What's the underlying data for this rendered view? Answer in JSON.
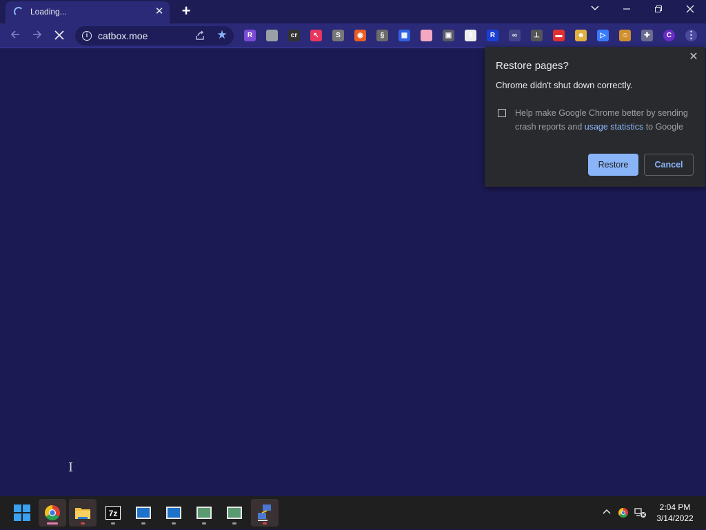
{
  "tab": {
    "title": "Loading..."
  },
  "toolbar": {
    "url": "catbox.moe"
  },
  "extensions": [
    {
      "name": "reader-ext-icon",
      "letter": "R",
      "color": "#7b4bd6"
    },
    {
      "name": "cloud-ext-icon",
      "letter": "",
      "color": "#9aa0a6"
    },
    {
      "name": "cr-ext-icon",
      "letter": "cr",
      "color": "#333333"
    },
    {
      "name": "cursor-ext-icon",
      "letter": "↖",
      "color": "#e8365d"
    },
    {
      "name": "s-ext-icon",
      "letter": "S",
      "color": "#777777"
    },
    {
      "name": "color-ext-icon",
      "letter": "◉",
      "color": "#e85d26"
    },
    {
      "name": "script-ext-icon",
      "letter": "§",
      "color": "#6b6b6b"
    },
    {
      "name": "grid-ext-icon",
      "letter": "▦",
      "color": "#2f63e0"
    },
    {
      "name": "flag-ext-icon",
      "letter": "",
      "color": "#f3a8c0"
    },
    {
      "name": "image-ext-icon",
      "letter": "▣",
      "color": "#5a5a6a"
    },
    {
      "name": "dollar-ext-icon",
      "letter": "$",
      "color": "#eeeeee"
    },
    {
      "name": "r-ext-icon",
      "letter": "R",
      "color": "#1a3fd6"
    },
    {
      "name": "link-ext-icon",
      "letter": "∞",
      "color": "#444488"
    },
    {
      "name": "stamp-ext-icon",
      "letter": "⊥",
      "color": "#555555"
    },
    {
      "name": "card-ext-icon",
      "letter": "▬",
      "color": "#e03030"
    },
    {
      "name": "cat-ext-icon",
      "letter": "☻",
      "color": "#e0b040"
    },
    {
      "name": "play-ext-icon",
      "letter": "▷",
      "color": "#3a7bfd"
    },
    {
      "name": "monkey-ext-icon",
      "letter": "☺",
      "color": "#d09030"
    },
    {
      "name": "puzzle-ext-icon",
      "letter": "✚",
      "color": "#6b6b90"
    },
    {
      "name": "profile-avatar-icon",
      "letter": "C",
      "color": "#6a2bc8"
    }
  ],
  "popup": {
    "title": "Restore pages?",
    "message": "Chrome didn't shut down correctly.",
    "consent_prefix": "Help make Google Chrome better by sending crash reports and ",
    "consent_link": "usage statistics",
    "consent_suffix": " to Google",
    "restore_label": "Restore",
    "cancel_label": "Cancel"
  },
  "taskbar": {
    "items": [
      "windows-start-icon",
      "chrome-icon",
      "file-explorer-icon",
      "7zip-icon",
      "window-icon-1",
      "window-icon-2",
      "window-icon-3",
      "window-icon-4",
      "network-tool-icon"
    ],
    "time": "2:04 PM",
    "date": "3/14/2022"
  }
}
